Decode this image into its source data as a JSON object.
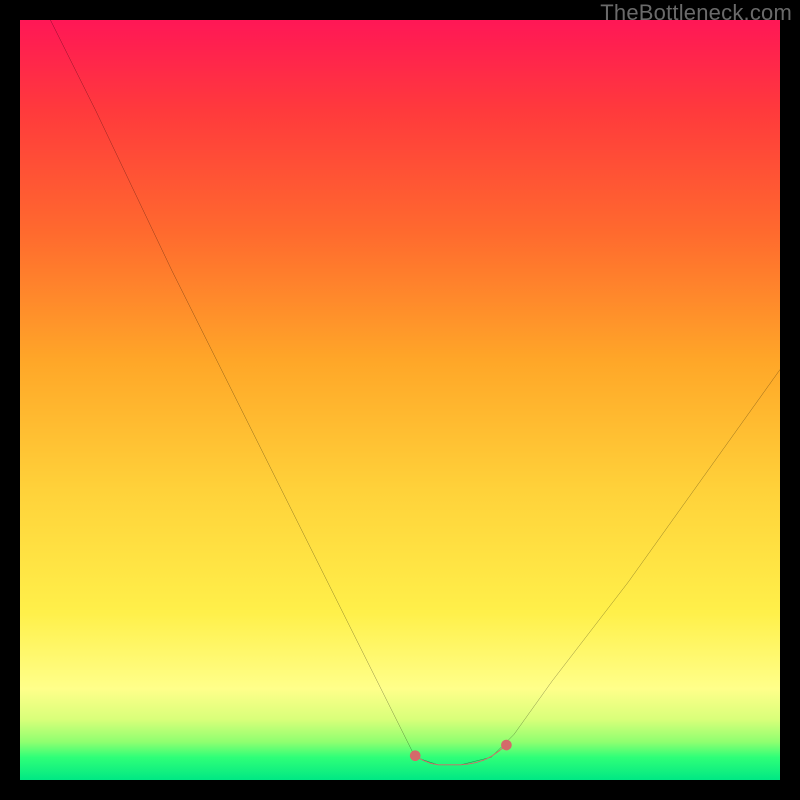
{
  "watermark": "TheBottleneck.com",
  "chart_data": {
    "type": "line",
    "title": "",
    "xlabel": "",
    "ylabel": "",
    "xlim": [
      0,
      100
    ],
    "ylim": [
      0,
      100
    ],
    "grid": false,
    "legend": false,
    "background_gradient": {
      "direction": "vertical",
      "stops": [
        {
          "pos": 0,
          "color": "#ff1756"
        },
        {
          "pos": 12,
          "color": "#ff3a3c"
        },
        {
          "pos": 28,
          "color": "#ff6a2e"
        },
        {
          "pos": 45,
          "color": "#ffa728"
        },
        {
          "pos": 62,
          "color": "#ffd23a"
        },
        {
          "pos": 78,
          "color": "#fff04a"
        },
        {
          "pos": 88,
          "color": "#ffff8a"
        },
        {
          "pos": 92,
          "color": "#d9ff7a"
        },
        {
          "pos": 95,
          "color": "#8fff70"
        },
        {
          "pos": 97,
          "color": "#2fff78"
        },
        {
          "pos": 100,
          "color": "#00e884"
        }
      ]
    },
    "series": [
      {
        "name": "bottleneck-curve",
        "stroke": "#000000",
        "stroke_width": 1.6,
        "x": [
          4,
          10,
          20,
          30,
          40,
          48,
          52,
          55,
          58,
          62,
          65,
          70,
          80,
          90,
          100
        ],
        "y": [
          100,
          88,
          67,
          47,
          27,
          11,
          3,
          2,
          2,
          3,
          6,
          13,
          26,
          40,
          54
        ]
      },
      {
        "name": "optimal-zone-marker",
        "stroke": "#d46a6a",
        "stroke_width": 6,
        "x": [
          52,
          53,
          54,
          55,
          56,
          57,
          58,
          59,
          60,
          61,
          62,
          63,
          64
        ],
        "y": [
          3.2,
          2.6,
          2.2,
          2.0,
          2.0,
          2.0,
          2.0,
          2.1,
          2.3,
          2.6,
          3.1,
          3.8,
          4.6
        ],
        "endpoints": [
          {
            "x": 52,
            "y": 3.2
          },
          {
            "x": 64,
            "y": 4.6
          }
        ]
      }
    ]
  }
}
